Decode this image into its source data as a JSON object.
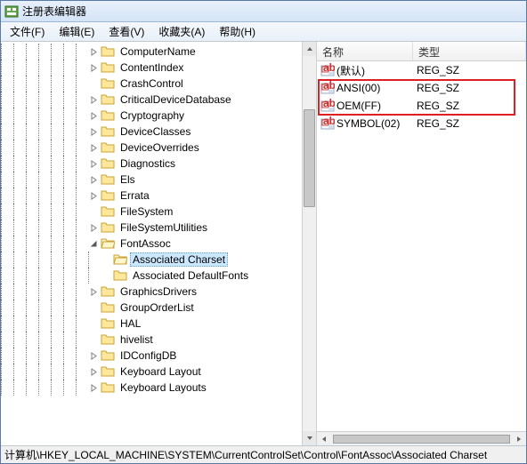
{
  "window": {
    "title": "注册表编辑器"
  },
  "menu": {
    "file": "文件(F)",
    "edit": "编辑(E)",
    "view": "查看(V)",
    "favorites": "收藏夹(A)",
    "help": "帮助(H)"
  },
  "tree": {
    "items": [
      {
        "label": "ComputerName",
        "expander": "closed",
        "depth": 7
      },
      {
        "label": "ContentIndex",
        "expander": "closed",
        "depth": 7
      },
      {
        "label": "CrashControl",
        "expander": "none",
        "depth": 7
      },
      {
        "label": "CriticalDeviceDatabase",
        "expander": "closed",
        "depth": 7
      },
      {
        "label": "Cryptography",
        "expander": "closed",
        "depth": 7
      },
      {
        "label": "DeviceClasses",
        "expander": "closed",
        "depth": 7
      },
      {
        "label": "DeviceOverrides",
        "expander": "closed",
        "depth": 7
      },
      {
        "label": "Diagnostics",
        "expander": "closed",
        "depth": 7
      },
      {
        "label": "Els",
        "expander": "closed",
        "depth": 7
      },
      {
        "label": "Errata",
        "expander": "closed",
        "depth": 7
      },
      {
        "label": "FileSystem",
        "expander": "none",
        "depth": 7
      },
      {
        "label": "FileSystemUtilities",
        "expander": "closed",
        "depth": 7
      },
      {
        "label": "FontAssoc",
        "expander": "open",
        "depth": 7
      },
      {
        "label": "Associated Charset",
        "expander": "none",
        "depth": 8,
        "selected": true
      },
      {
        "label": "Associated DefaultFonts",
        "expander": "none",
        "depth": 8
      },
      {
        "label": "GraphicsDrivers",
        "expander": "closed",
        "depth": 7
      },
      {
        "label": "GroupOrderList",
        "expander": "none",
        "depth": 7
      },
      {
        "label": "HAL",
        "expander": "none",
        "depth": 7
      },
      {
        "label": "hivelist",
        "expander": "none",
        "depth": 7
      },
      {
        "label": "IDConfigDB",
        "expander": "closed",
        "depth": 7
      },
      {
        "label": "Keyboard Layout",
        "expander": "closed",
        "depth": 7
      },
      {
        "label": "Keyboard Layouts",
        "expander": "closed",
        "depth": 7
      }
    ]
  },
  "list": {
    "col_name": "名称",
    "col_type": "类型",
    "rows": [
      {
        "name": "(默认)",
        "type": "REG_SZ"
      },
      {
        "name": "ANSI(00)",
        "type": "REG_SZ"
      },
      {
        "name": "OEM(FF)",
        "type": "REG_SZ"
      },
      {
        "name": "SYMBOL(02)",
        "type": "REG_SZ"
      }
    ]
  },
  "statusbar": {
    "path": "计算机\\HKEY_LOCAL_MACHINE\\SYSTEM\\CurrentControlSet\\Control\\FontAssoc\\Associated Charset"
  }
}
